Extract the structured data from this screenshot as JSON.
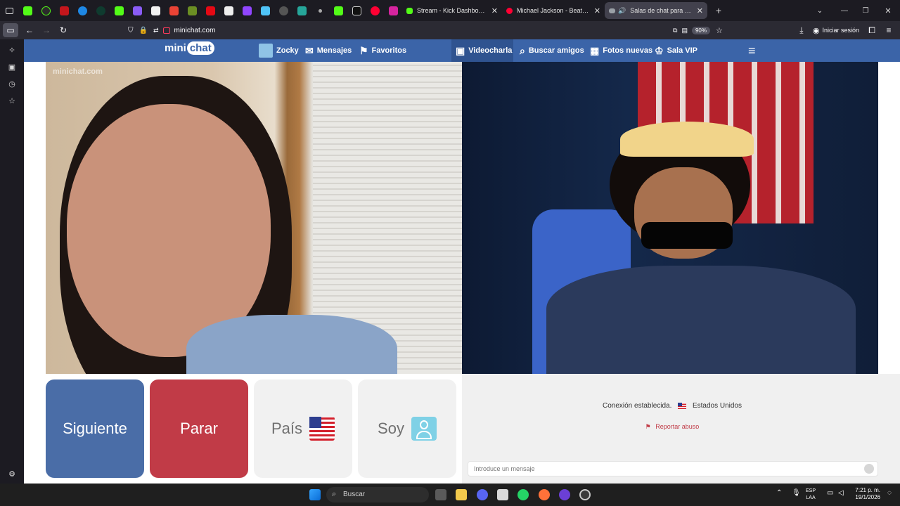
{
  "browser": {
    "tabs": [
      {
        "title": "Stream - Kick Dashboard",
        "color": "#53fc18"
      },
      {
        "title": "Michael Jackson - Beat It (Offici",
        "color": "#ff0033"
      },
      {
        "title": "Salas de chat para videochat",
        "color": "#9aa0a6"
      }
    ],
    "url": "minichat.com",
    "zoom": "90%",
    "sign_in": "Iniciar sesión"
  },
  "site": {
    "logo_main": "mini",
    "logo_chat": "chat",
    "nav": {
      "user": "Zocky",
      "messages": "Mensajes",
      "favorites": "Favoritos",
      "videochat": "Videocharla",
      "find_friends": "Buscar amigos",
      "new_photos": "Fotos nuevas",
      "vip": "Sala VIP"
    },
    "watermark": "minichat.com",
    "buttons": {
      "next": "Siguiente",
      "stop": "Parar",
      "country": "País",
      "gender": "Soy"
    },
    "status": "Conexión establecida.",
    "country": "Estados Unidos",
    "report": "Reportar abuso",
    "message_placeholder": "Introduce un mensaje"
  },
  "taskbar": {
    "search": "Buscar",
    "lang_top": "ESP",
    "lang_bottom": "LAA",
    "time": "7:21 p. m.",
    "date": "19/1/2026"
  }
}
